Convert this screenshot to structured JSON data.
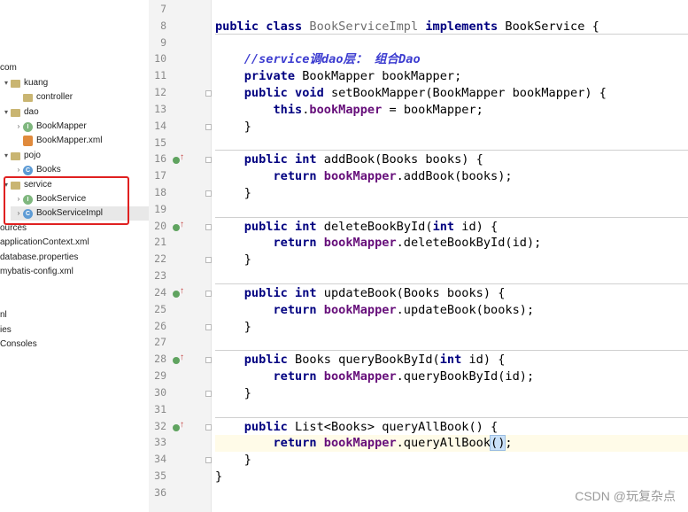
{
  "tree": {
    "items": [
      {
        "label": "com",
        "icon": "none",
        "indent": 0,
        "arrow": ""
      },
      {
        "label": "kuang",
        "icon": "folder",
        "indent": 1,
        "arrow": "v"
      },
      {
        "label": "controller",
        "icon": "folder",
        "indent": 2,
        "arrow": ""
      },
      {
        "label": "dao",
        "icon": "folder",
        "indent": 1,
        "arrow": "v"
      },
      {
        "label": "BookMapper",
        "icon": "interface",
        "indent": 2,
        "arrow": ">"
      },
      {
        "label": "BookMapper.xml",
        "icon": "xml",
        "indent": 2,
        "arrow": ""
      },
      {
        "label": "pojo",
        "icon": "folder",
        "indent": 1,
        "arrow": "v"
      },
      {
        "label": "Books",
        "icon": "class",
        "indent": 2,
        "arrow": ">"
      },
      {
        "label": "service",
        "icon": "folder",
        "indent": 1,
        "arrow": "v"
      },
      {
        "label": "BookService",
        "icon": "interface",
        "indent": 2,
        "arrow": ">"
      },
      {
        "label": "BookServiceImpl",
        "icon": "class",
        "indent": 2,
        "arrow": ">",
        "selected": true
      },
      {
        "label": "ources",
        "icon": "none",
        "indent": 0,
        "arrow": ""
      },
      {
        "label": "applicationContext.xml",
        "icon": "none",
        "indent": 0,
        "arrow": ""
      },
      {
        "label": "database.properties",
        "icon": "none",
        "indent": 0,
        "arrow": ""
      },
      {
        "label": "mybatis-config.xml",
        "icon": "none",
        "indent": 0,
        "arrow": ""
      },
      {
        "label": "",
        "icon": "none",
        "indent": 0,
        "arrow": ""
      },
      {
        "label": "nl",
        "icon": "none",
        "indent": 0,
        "arrow": ""
      },
      {
        "label": "ies",
        "icon": "none",
        "indent": 0,
        "arrow": ""
      },
      {
        "label": "Consoles",
        "icon": "none",
        "indent": 0,
        "arrow": ""
      }
    ]
  },
  "editor": {
    "lines": [
      {
        "n": "7",
        "code": ""
      },
      {
        "n": "8",
        "code": "public class BookServiceImpl implements BookService {"
      },
      {
        "n": "9",
        "code": ""
      },
      {
        "n": "10",
        "code": "    //service调dao层： 组合Dao"
      },
      {
        "n": "11",
        "code": "    private BookMapper bookMapper;"
      },
      {
        "n": "12",
        "code": "    public void setBookMapper(BookMapper bookMapper) {"
      },
      {
        "n": "13",
        "code": "        this.bookMapper = bookMapper;"
      },
      {
        "n": "14",
        "code": "    }"
      },
      {
        "n": "15",
        "code": ""
      },
      {
        "n": "16",
        "code": "    public int addBook(Books books) {"
      },
      {
        "n": "17",
        "code": "        return bookMapper.addBook(books);"
      },
      {
        "n": "18",
        "code": "    }"
      },
      {
        "n": "19",
        "code": ""
      },
      {
        "n": "20",
        "code": "    public int deleteBookById(int id) {"
      },
      {
        "n": "21",
        "code": "        return bookMapper.deleteBookById(id);"
      },
      {
        "n": "22",
        "code": "    }"
      },
      {
        "n": "23",
        "code": ""
      },
      {
        "n": "24",
        "code": "    public int updateBook(Books books) {"
      },
      {
        "n": "25",
        "code": "        return bookMapper.updateBook(books);"
      },
      {
        "n": "26",
        "code": "    }"
      },
      {
        "n": "27",
        "code": ""
      },
      {
        "n": "28",
        "code": "    public Books queryBookById(int id) {"
      },
      {
        "n": "29",
        "code": "        return bookMapper.queryBookById(id);"
      },
      {
        "n": "30",
        "code": "    }"
      },
      {
        "n": "31",
        "code": ""
      },
      {
        "n": "32",
        "code": "    public List<Books> queryAllBook() {"
      },
      {
        "n": "33",
        "code": "        return bookMapper.queryAllBook();"
      },
      {
        "n": "34",
        "code": "    }"
      },
      {
        "n": "35",
        "code": "}"
      },
      {
        "n": "36",
        "code": ""
      }
    ]
  },
  "watermark": "CSDN @玩复杂点",
  "colors": {
    "keyword": "#000080",
    "field": "#660e7a",
    "comment": "#3c3cd0",
    "highlight_box": "#e02020"
  }
}
